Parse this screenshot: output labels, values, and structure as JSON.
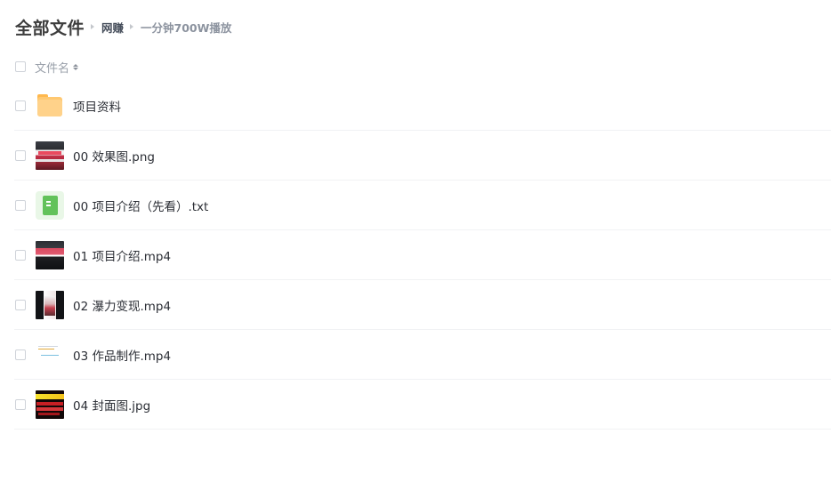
{
  "breadcrumb": {
    "root": "全部文件",
    "parent": "网赚",
    "current": "一分钟700W播放"
  },
  "header": {
    "column_name": "文件名"
  },
  "files": [
    {
      "name": "项目资料",
      "type": "folder",
      "icon": "folder-icon"
    },
    {
      "name": "00 效果图.png",
      "type": "image",
      "icon": "image-thumbnail"
    },
    {
      "name": "00 项目介绍（先看）.txt",
      "type": "text",
      "icon": "text-file-icon"
    },
    {
      "name": "01 项目介绍.mp4",
      "type": "video",
      "icon": "video-thumbnail"
    },
    {
      "name": "02 瀑力变现.mp4",
      "type": "video",
      "icon": "video-thumbnail"
    },
    {
      "name": "03 作品制作.mp4",
      "type": "video",
      "icon": "video-thumbnail"
    },
    {
      "name": "04 封面图.jpg",
      "type": "image",
      "icon": "image-thumbnail"
    }
  ],
  "colors": {
    "folder": "#ffc870",
    "text_file": "#62c25a",
    "divider": "#f1f2f4"
  }
}
